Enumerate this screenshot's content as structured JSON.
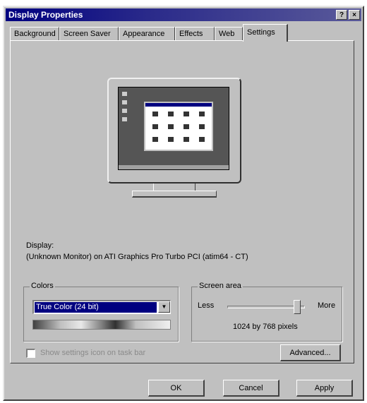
{
  "window": {
    "title": "Display Properties",
    "help_label": "?",
    "close_label": "×"
  },
  "tabs": [
    {
      "label": "Background"
    },
    {
      "label": "Screen Saver"
    },
    {
      "label": "Appearance"
    },
    {
      "label": "Effects"
    },
    {
      "label": "Web"
    },
    {
      "label": "Settings"
    }
  ],
  "active_tab": "Settings",
  "display": {
    "label": "Display:",
    "value": "(Unknown Monitor) on ATI Graphics Pro Turbo PCI (atim64 - CT)"
  },
  "colors": {
    "label": "Colors",
    "selected": "True Color (24 bit)"
  },
  "screen_area": {
    "label": "Screen area",
    "less_label": "Less",
    "more_label": "More",
    "value_text": "1024 by 768 pixels",
    "slider_level": 0.9
  },
  "checkbox": {
    "label": "Show settings icon on task bar",
    "checked": false
  },
  "buttons": {
    "advanced": "Advanced...",
    "ok": "OK",
    "cancel": "Cancel",
    "apply": "Apply"
  },
  "icons": [
    "help-icon",
    "close-icon",
    "dropdown-arrow-icon"
  ]
}
